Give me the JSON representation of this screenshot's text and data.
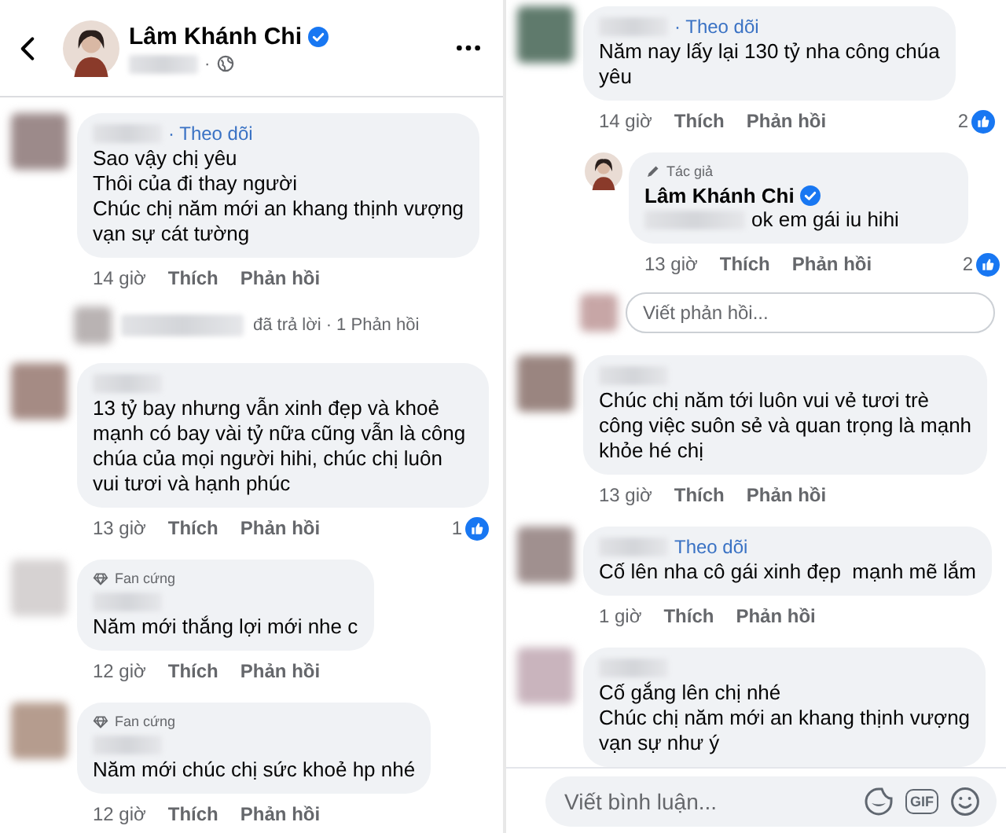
{
  "header": {
    "title": "Lâm Khánh Chi",
    "verified": true,
    "separator": "·"
  },
  "columns": [
    {
      "items": [
        {
          "kind": "comment",
          "follow": "· Theo dõi",
          "text": "Sao vậy chị yêu\nThôi của đi thay người\nChúc chị năm mới an khang thịnh vượng\nvạn sự cát tường",
          "time": "14 giờ",
          "like": "Thích",
          "reply": "Phản hồi"
        },
        {
          "kind": "replies",
          "text": "đã trả lời · 1 Phản hồi"
        },
        {
          "kind": "comment",
          "text": "13 tỷ bay nhưng vẫn xinh đẹp và khoẻ mạnh có bay vài tỷ nữa cũng vẫn là công chúa của mọi người hihi, chúc chị luôn vui tươi và hạnh phúc",
          "time": "13 giờ",
          "like": "Thích",
          "reply": "Phản hồi",
          "reactions": "1"
        },
        {
          "kind": "comment",
          "badge": {
            "kind": "fan",
            "label": "Fan cứng"
          },
          "text": "Năm mới thắng lợi mới nhe c",
          "time": "12 giờ",
          "like": "Thích",
          "reply": "Phản hồi"
        },
        {
          "kind": "comment",
          "badge": {
            "kind": "fan",
            "label": "Fan cứng"
          },
          "text": "Năm mới chúc chị sức khoẻ hp nhé",
          "time": "12 giờ",
          "like": "Thích",
          "reply": "Phản hồi"
        }
      ]
    },
    {
      "items": [
        {
          "kind": "comment",
          "follow": "· Theo dõi",
          "text": "Năm nay lấy lại 130 tỷ nha công chúa\nyêu",
          "time": "14 giờ",
          "like": "Thích",
          "reply": "Phản hồi",
          "reactions": "2",
          "children": [
            {
              "kind": "comment",
              "badge": {
                "kind": "author",
                "label": "Tác giả"
              },
              "author": "Lâm Khánh Chi",
              "verified": true,
              "mention": true,
              "text": "ok em gái iu hihi",
              "time": "13 giờ",
              "like": "Thích",
              "reply": "Phản hồi",
              "reactions": "2"
            }
          ]
        },
        {
          "kind": "reply_input",
          "placeholder": "Viết phản hồi..."
        },
        {
          "kind": "comment",
          "text": "Chúc chị năm tới luôn vui vẻ tươi trè\ncông việc suôn sẻ và quan trọng là mạnh\nkhỏe hé chị",
          "time": "13 giờ",
          "like": "Thích",
          "reply": "Phản hồi"
        },
        {
          "kind": "comment",
          "follow": "Theo dõi",
          "text": "Cố lên nha cô gái xinh đẹp  mạnh mẽ lắm",
          "time": "1 giờ",
          "like": "Thích",
          "reply": "Phản hồi"
        },
        {
          "kind": "comment",
          "text": "Cố gắng lên chị nhé\nChúc chị năm mới an khang thịnh vượng\nvạn sự như ý"
        }
      ],
      "composer": {
        "placeholder": "Viết bình luận...",
        "gif": "GIF"
      }
    }
  ]
}
